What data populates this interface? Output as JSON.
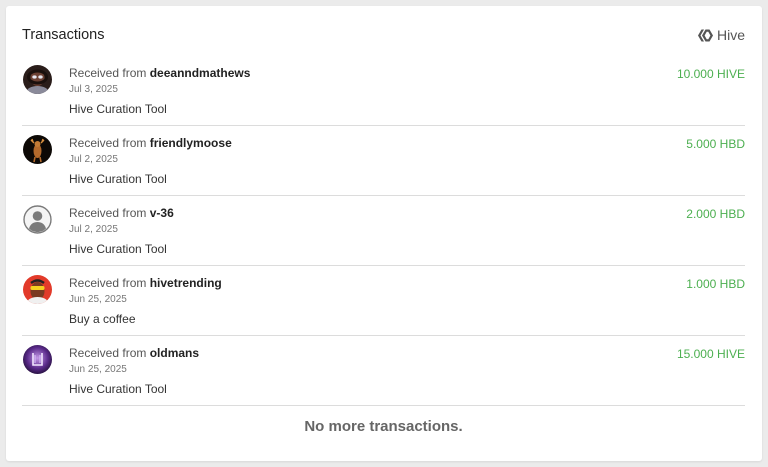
{
  "header": {
    "title": "Transactions",
    "brand_label": "Hive"
  },
  "transactions": [
    {
      "prefix": "Received from",
      "user": "deeanndmathews",
      "date": "Jul 3, 2025",
      "memo": "Hive Curation Tool",
      "amount": "10.000 HIVE",
      "avatar": "avatar-photo-woman"
    },
    {
      "prefix": "Received from",
      "user": "friendlymoose",
      "date": "Jul 2, 2025",
      "memo": "Hive Curation Tool",
      "amount": "5.000 HBD",
      "avatar": "avatar-moose"
    },
    {
      "prefix": "Received from",
      "user": "v-36",
      "date": "Jul 2, 2025",
      "memo": "Hive Curation Tool",
      "amount": "2.000 HBD",
      "avatar": "default-user-icon"
    },
    {
      "prefix": "Received from",
      "user": "hivetrending",
      "date": "Jun 25, 2025",
      "memo": "Buy a coffee",
      "amount": "1.000 HBD",
      "avatar": "avatar-sunglasses"
    },
    {
      "prefix": "Received from",
      "user": "oldmans",
      "date": "Jun 25, 2025",
      "memo": "Hive Curation Tool",
      "amount": "15.000 HIVE",
      "avatar": "avatar-purple"
    }
  ],
  "footer": {
    "text": "No more transactions."
  },
  "colors": {
    "amount": "#4caf50",
    "divider": "#dcdcdc",
    "background": "#ebebeb",
    "card": "#ffffff"
  }
}
